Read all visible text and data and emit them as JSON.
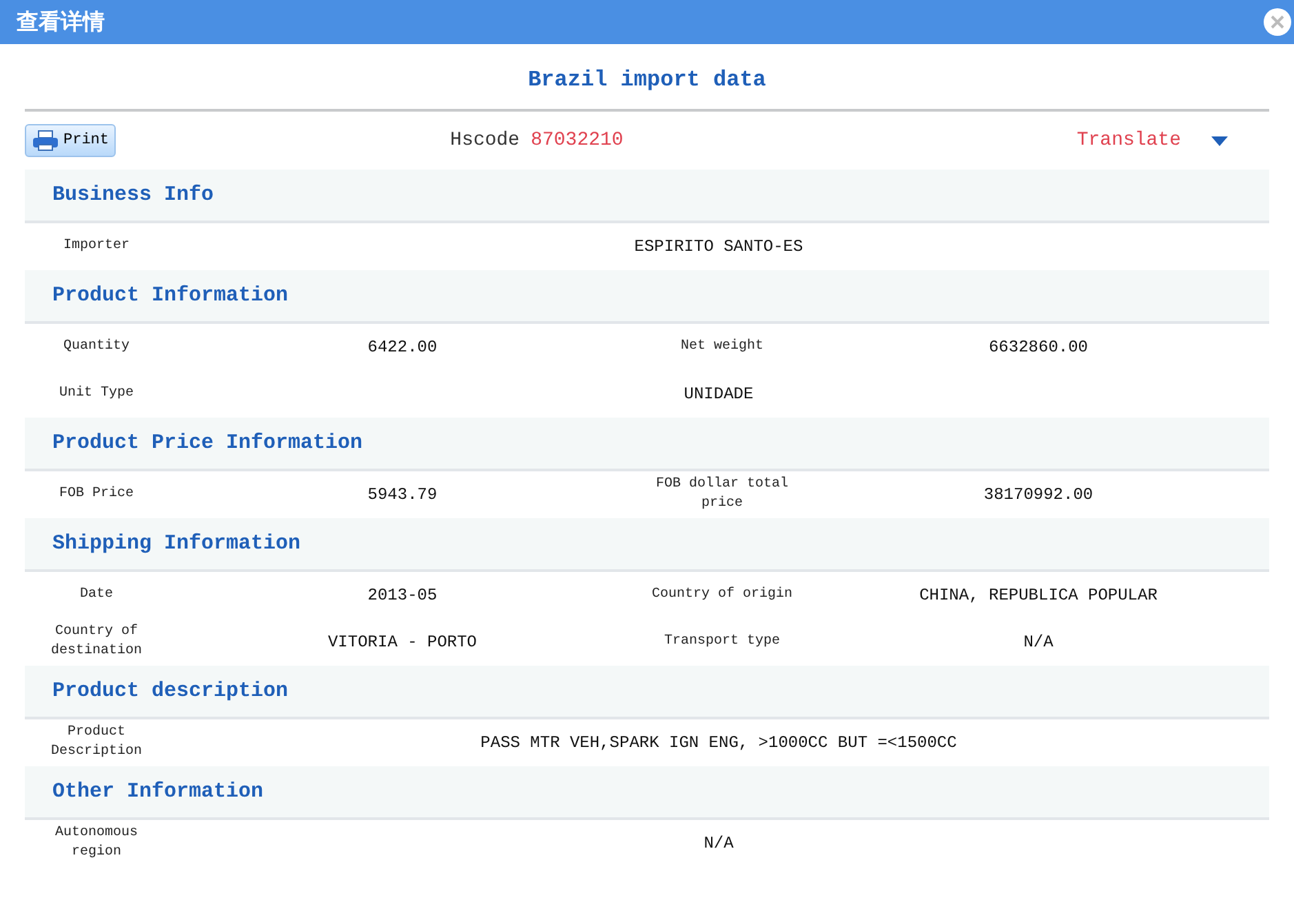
{
  "window": {
    "title": "查看详情"
  },
  "heading": "Brazil import data",
  "toolbar": {
    "print": "Print",
    "hscode_label": "Hscode",
    "hscode": "87032210",
    "translate": "Translate"
  },
  "sections": [
    {
      "title": "Business Info",
      "rows": [
        {
          "fields": [
            {
              "label": "Importer",
              "value": "ESPIRITO SANTO-ES"
            }
          ]
        }
      ]
    },
    {
      "title": "Product Information",
      "rows": [
        {
          "fields": [
            {
              "label": "Quantity",
              "value": "6422.00"
            },
            {
              "label": "Net weight",
              "value": "6632860.00"
            }
          ]
        },
        {
          "fields": [
            {
              "label": "Unit Type",
              "value": "UNIDADE"
            }
          ]
        }
      ]
    },
    {
      "title": "Product Price Information",
      "rows": [
        {
          "fields": [
            {
              "label": "FOB Price",
              "value": "5943.79"
            },
            {
              "label": "FOB dollar total price",
              "value": "38170992.00"
            }
          ]
        }
      ]
    },
    {
      "title": "Shipping Information",
      "rows": [
        {
          "fields": [
            {
              "label": "Date",
              "value": "2013-05"
            },
            {
              "label": "Country of origin",
              "value": "CHINA, REPUBLICA POPULAR"
            }
          ]
        },
        {
          "fields": [
            {
              "label": "Country of destination",
              "value": "VITORIA - PORTO"
            },
            {
              "label": "Transport type",
              "value": "N/A"
            }
          ]
        }
      ]
    },
    {
      "title": "Product description",
      "rows": [
        {
          "fields": [
            {
              "label": "Product Description",
              "value": "PASS MTR VEH,SPARK IGN ENG, >1000CC BUT =<1500CC"
            }
          ]
        }
      ]
    },
    {
      "title": "Other Information",
      "rows": [
        {
          "fields": [
            {
              "label": "Autonomous region",
              "value": "N/A"
            }
          ]
        }
      ]
    }
  ]
}
